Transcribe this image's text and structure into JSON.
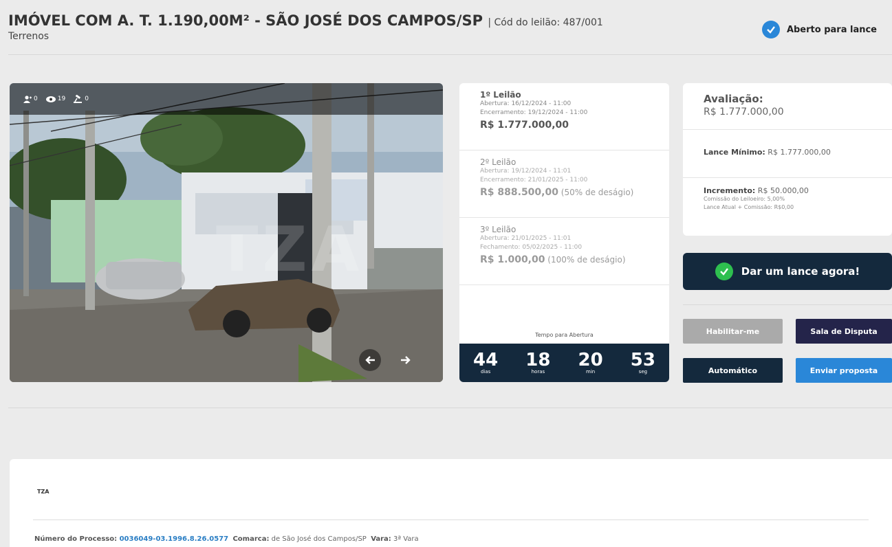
{
  "header": {
    "title": "IMÓVEL COM A. T. 1.190,00M² - SÃO JOSÉ DOS CAMPOS/SP",
    "code": "| Cód do leilão: 487/001",
    "category": "Terrenos",
    "status": "Aberto para lance"
  },
  "gallery": {
    "stats": {
      "users": "0",
      "views": "19",
      "bids": "0"
    },
    "watermark": "TZA",
    "icons": [
      "user-icon",
      "eye-icon",
      "gavel-icon",
      "arrow-left-icon",
      "arrow-right-icon"
    ]
  },
  "rounds": [
    {
      "title": "1º Leilão",
      "line1": "Abertura:  16/12/2024 - 11:00",
      "line2": "Encerramento:  19/12/2024 - 11:00",
      "value": "R$ 1.777.000,00",
      "discount": ""
    },
    {
      "title": "2º Leilão",
      "line1": "Abertura:  19/12/2024 - 11:01",
      "line2": "Encerramento:  21/01/2025 - 11:00",
      "value": "R$ 888.500,00",
      "discount": " (50% de deságio)"
    },
    {
      "title": "3º Leilão",
      "line1": "Abertura:  21/01/2025 - 11:01",
      "line2": "Fechamento:  05/02/2025 - 11:00",
      "value": "R$ 1.000,00",
      "discount": " (100% de deságio)"
    }
  ],
  "timer": {
    "label": "Tempo para Abertura",
    "days": "44",
    "days_label": "dias",
    "hours": "18",
    "hours_label": "horas",
    "minutes": "20",
    "minutes_label": "min",
    "seconds": "53",
    "seconds_label": "seg"
  },
  "evaluation": {
    "heading": "Avaliação:",
    "value": "R$ 1.777.000,00",
    "min_bid_label": "Lance Mínimo:",
    "min_bid_value": " R$ 1.777.000,00",
    "increment_label": "Incremento:",
    "increment_value": " R$ 50.000,00",
    "commission": "Comissão do Leiloeiro: 5,00%",
    "current_plus": "Lance Atual + Comissão: R$0,00"
  },
  "actions": {
    "bid_now": "Dar um lance agora!",
    "enable": "Habilitar-me",
    "dispute_room": "Sala de Disputa",
    "automatic": "Automático",
    "send_proposal": "Enviar proposta"
  },
  "info": {
    "logo": "TZA",
    "process_label": "Número do Processo:",
    "process_number": " 0036049-03.1996.8.26.0577",
    "comarca_label": "Comarca:",
    "comarca_value": " de São José dos Campos/SP",
    "vara_label": "Vara:",
    "vara_value": " 3ª Vara"
  },
  "colors": {
    "navy": "#14293d",
    "blue": "#2a87d8",
    "green": "#2ebf4f",
    "purple": "#24244a",
    "gray_button": "#aaaaaa"
  }
}
